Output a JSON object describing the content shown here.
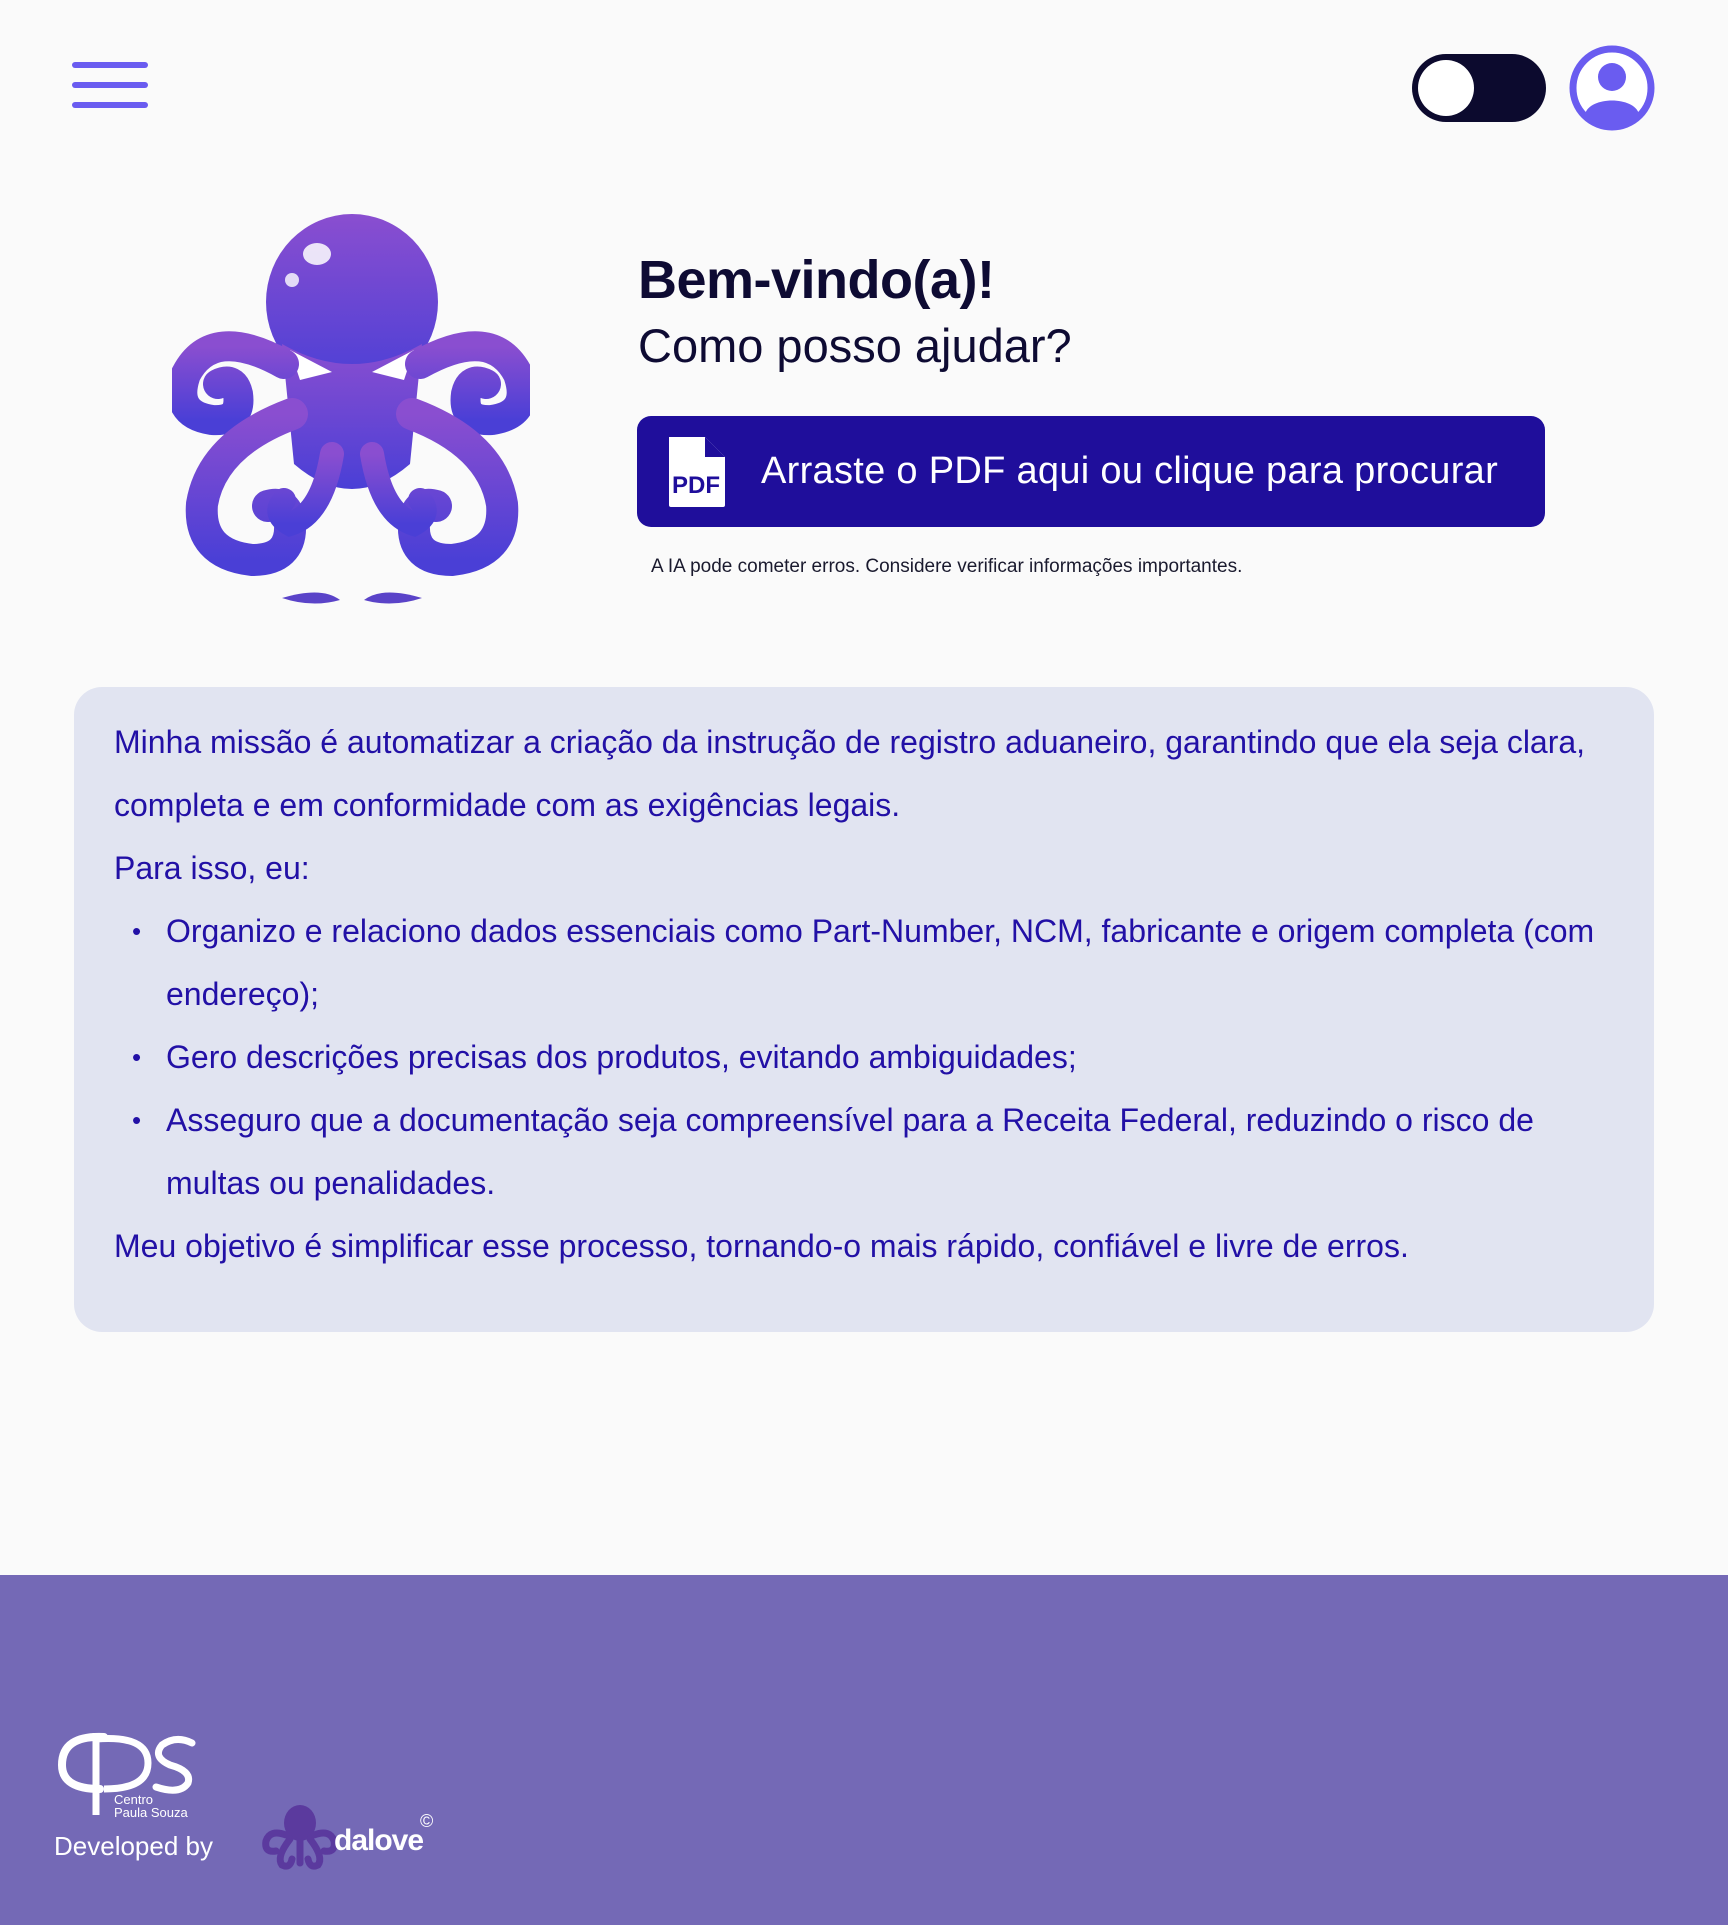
{
  "header": {
    "menu_icon": "hamburger-menu-icon",
    "theme_toggle": {
      "state": "off",
      "icon": "toggle-switch"
    },
    "profile_icon": "user-circle-icon"
  },
  "hero": {
    "logo_icon": "octopus-logo",
    "title": "Bem-vindo(a)!",
    "subtitle": "Como posso ajudar?",
    "upload": {
      "icon": "pdf-file-icon",
      "icon_text": "PDF",
      "label": "Arraste o PDF aqui ou clique para procurar"
    },
    "disclaimer": "A IA pode cometer erros. Considere verificar informações importantes."
  },
  "mission": {
    "intro": "Minha missão é automatizar a criação da instrução de registro aduaneiro, garantindo que ela seja clara, completa e em conformidade com as exigências legais.",
    "lead": "Para isso, eu:",
    "items": [
      "Organizo e relaciono dados essenciais como Part-Number, NCM, fabricante e origem completa (com endereço);",
      "Gero descrições precisas dos produtos, evitando ambiguidades;",
      " Asseguro que a documentação seja compreensível para a Receita Federal, reduzindo o risco de multas ou penalidades."
    ],
    "closing": "Meu objetivo é simplificar esse processo, tornando-o mais rápido, confiável e livre de erros."
  },
  "footer": {
    "cps_logo": "cps",
    "cps_subtitle_1": "Centro",
    "cps_subtitle_2": "Paula Souza",
    "developed_by": "Developed by",
    "dalove_name": "dalove",
    "dalove_mark": "©"
  },
  "colors": {
    "accent": "#6a5cf0",
    "primary_button": "#1f0e9b",
    "mission_text": "#2210a6",
    "card_bg": "#e1e4f1",
    "footer_bg": "#7469b6"
  }
}
